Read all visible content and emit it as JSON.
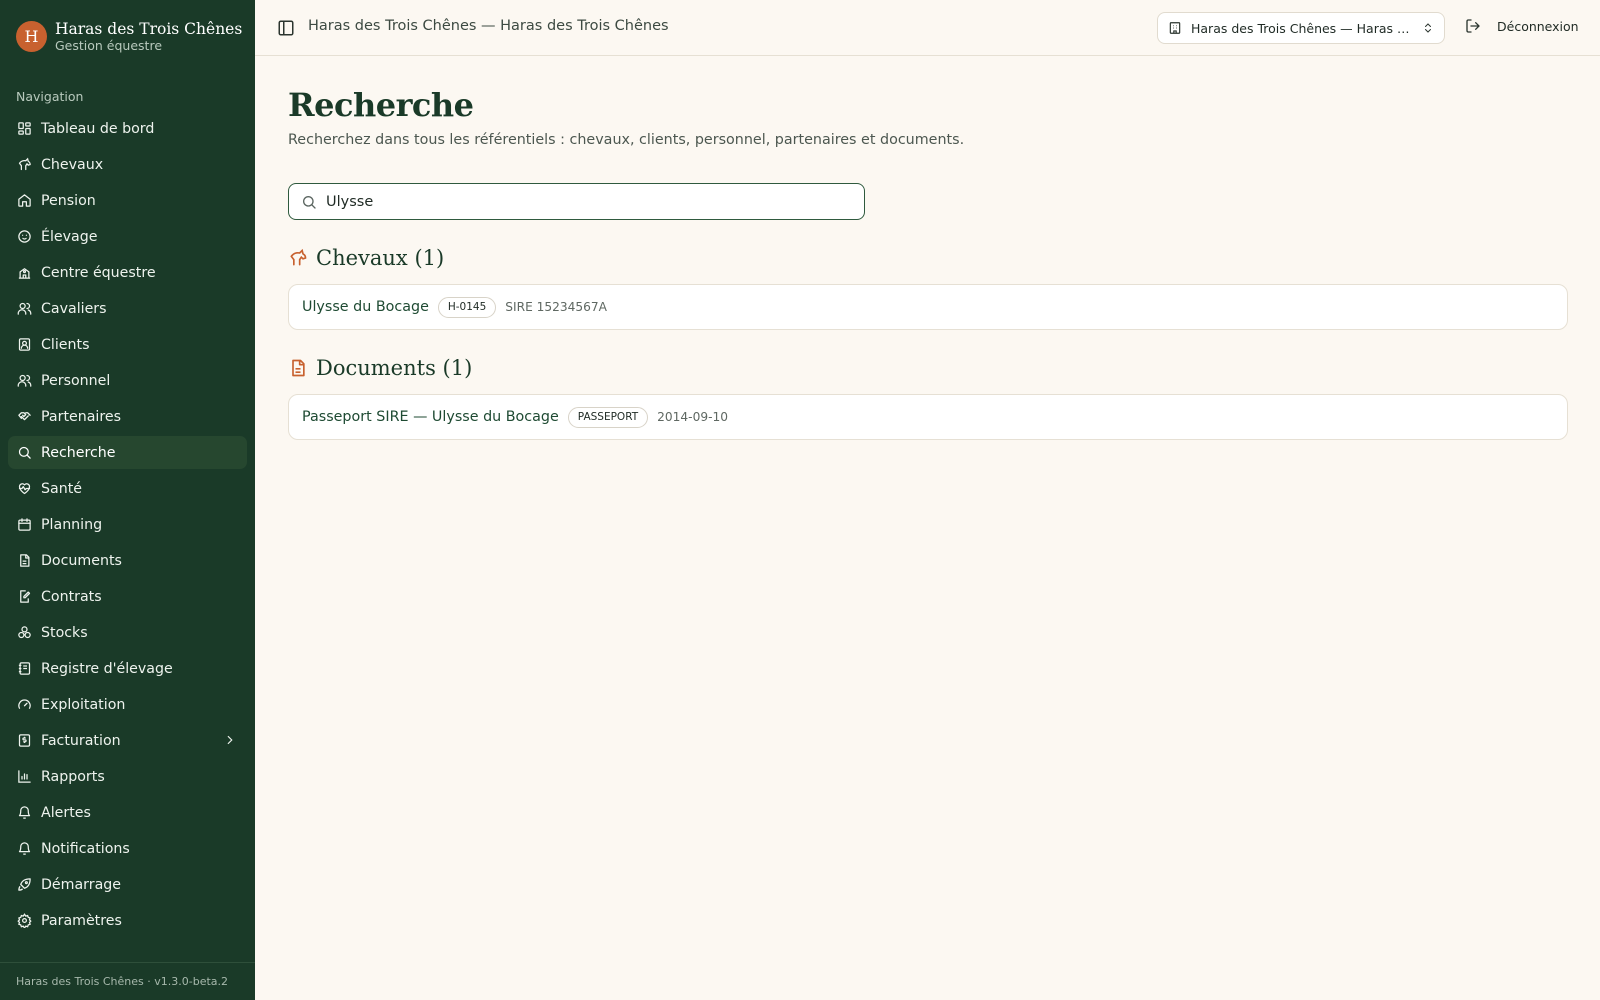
{
  "brand": {
    "initial": "H",
    "name": "Haras des Trois Chênes",
    "subtitle": "Gestion équestre"
  },
  "sidebar": {
    "heading": "Navigation",
    "items": [
      {
        "label": "Tableau de bord",
        "icon": "dashboard-icon"
      },
      {
        "label": "Chevaux",
        "icon": "horse-icon"
      },
      {
        "label": "Pension",
        "icon": "house-icon"
      },
      {
        "label": "Élevage",
        "icon": "baby-icon"
      },
      {
        "label": "Centre équestre",
        "icon": "school-icon"
      },
      {
        "label": "Cavaliers",
        "icon": "users-icon"
      },
      {
        "label": "Clients",
        "icon": "contact-icon"
      },
      {
        "label": "Personnel",
        "icon": "users-icon"
      },
      {
        "label": "Partenaires",
        "icon": "handshake-icon"
      },
      {
        "label": "Recherche",
        "icon": "search-icon",
        "active": true
      },
      {
        "label": "Santé",
        "icon": "heart-pulse-icon"
      },
      {
        "label": "Planning",
        "icon": "calendar-icon"
      },
      {
        "label": "Documents",
        "icon": "file-text-icon"
      },
      {
        "label": "Contrats",
        "icon": "file-signature-icon"
      },
      {
        "label": "Stocks",
        "icon": "boxes-icon"
      },
      {
        "label": "Registre d'élevage",
        "icon": "notebook-icon"
      },
      {
        "label": "Exploitation",
        "icon": "gauge-icon"
      },
      {
        "label": "Facturation",
        "icon": "receipt-icon",
        "expandable": true
      },
      {
        "label": "Rapports",
        "icon": "bar-chart-icon"
      },
      {
        "label": "Alertes",
        "icon": "bell-icon"
      },
      {
        "label": "Notifications",
        "icon": "bell-icon"
      },
      {
        "label": "Démarrage",
        "icon": "rocket-icon"
      },
      {
        "label": "Paramètres",
        "icon": "gear-icon"
      }
    ],
    "footer": "Haras des Trois Chênes · v1.3.0-beta.2"
  },
  "topbar": {
    "title": "Haras des Trois Chênes — Haras des Trois Chênes",
    "org_select": "Haras des Trois Chênes — Haras des Trois Chênes",
    "logout": "Déconnexion"
  },
  "page": {
    "title": "Recherche",
    "description": "Recherchez dans tous les référentiels : chevaux, clients, personnel, partenaires et documents.",
    "search_value": "Ulysse"
  },
  "results": {
    "horses": {
      "title": "Chevaux (1)",
      "items": [
        {
          "name": "Ulysse du Bocage",
          "badge": "H-0145",
          "meta": "SIRE 15234567A"
        }
      ]
    },
    "documents": {
      "title": "Documents (1)",
      "items": [
        {
          "name": "Passeport SIRE — Ulysse du Bocage",
          "badge": "PASSEPORT",
          "meta": "2014-09-10"
        }
      ]
    }
  },
  "colors": {
    "sidebar": "#1a3a28",
    "accent": "#c8612f",
    "background": "#fcf8f2"
  }
}
